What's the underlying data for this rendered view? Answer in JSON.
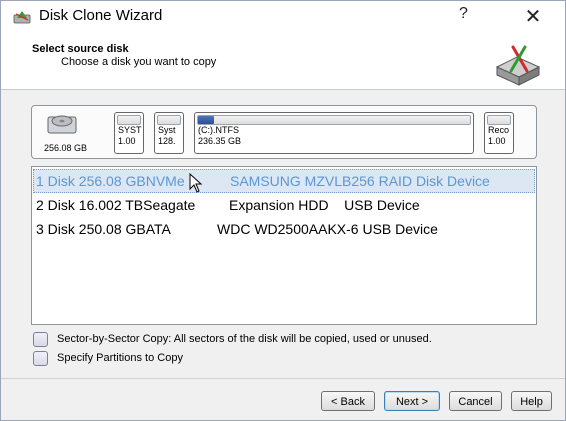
{
  "window": {
    "title": "Disk Clone Wizard",
    "help_glyph": "?",
    "close_glyph": "✕"
  },
  "header": {
    "step_title": "Select source disk",
    "step_subtitle": "Choose a disk you want to copy"
  },
  "disk_map": {
    "disk_size": "256.08 GB",
    "partitions": [
      {
        "name": "SYST",
        "size": "1.00",
        "used_fraction": 0.0
      },
      {
        "name": "Syst",
        "size": "128.",
        "used_fraction": 0.0
      },
      {
        "name": "(C:).NTFS",
        "size": "236.35 GB",
        "used_fraction": 0.06
      },
      {
        "name": "Reco",
        "size": "1.00",
        "used_fraction": 0.0
      }
    ]
  },
  "disks": [
    {
      "id": "1 Disk 256.08 GBNVMe",
      "model": "SAMSUNG MZVLB256 RAID Disk Device",
      "selected": true
    },
    {
      "id": "2 Disk 16.002 TBSeagate",
      "model": "Expansion HDD    USB Device",
      "selected": false
    },
    {
      "id": "3 Disk 250.08 GBATA",
      "model": "WDC WD2500AAKX-6 USB Device",
      "selected": false
    }
  ],
  "options": {
    "sector_by_sector": "Sector-by-Sector Copy: All sectors of the disk will be copied, used or unused.",
    "specify_partitions": "Specify Partitions to Copy"
  },
  "buttons": {
    "back": "< Back",
    "next": "Next >",
    "cancel": "Cancel",
    "help": "Help"
  },
  "icons": {
    "app": "disk-clone-app-icon",
    "wizard": "disk-clone-wizard-icon",
    "disk": "hard-disk-icon",
    "cursor": "mouse-cursor-icon"
  },
  "colors": {
    "selection_bg": "#dde7f3",
    "selection_text": "#5b97d4",
    "partition_fill": "#2c4f96"
  }
}
